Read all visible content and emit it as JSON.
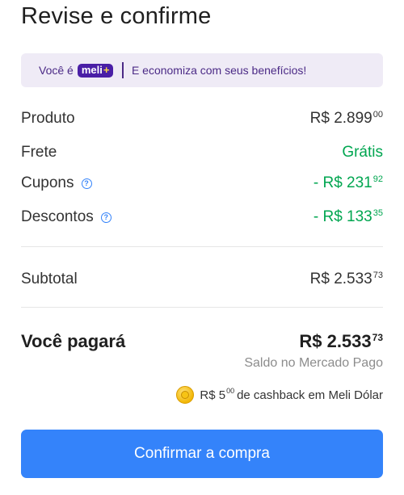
{
  "page": {
    "title": "Revise e confirme"
  },
  "banner": {
    "prefix": "Você é",
    "badge_text": "meli",
    "badge_plus": "+",
    "message": "E economiza com seus benefícios!",
    "colors": {
      "background": "#efebf6",
      "text": "#4b2a86",
      "badge": "#4a1fa6"
    }
  },
  "summary": {
    "produto": {
      "label": "Produto",
      "main": "R$ 2.899",
      "cents": "00"
    },
    "frete": {
      "label": "Frete",
      "value": "Grátis"
    },
    "cupons": {
      "label": "Cupons",
      "main": "- R$ 231",
      "cents": "92",
      "icon": "help-circle-icon"
    },
    "descontos": {
      "label": "Descontos",
      "main": "- R$ 133",
      "cents": "35",
      "icon": "help-circle-icon"
    },
    "subtotal": {
      "label": "Subtotal",
      "main": "R$ 2.533",
      "cents": "73"
    }
  },
  "total": {
    "label": "Você pagará",
    "main": "R$ 2.533",
    "cents": "73",
    "payment_method": "Saldo no Mercado Pago"
  },
  "cashback": {
    "icon": "coin-icon",
    "amount_main": "R$ 5",
    "amount_cents": "00",
    "text": "de cashback em Meli Dólar"
  },
  "actions": {
    "confirm_label": "Confirmar a compra"
  },
  "colors": {
    "accent": "#3483fa",
    "positive": "#00a650",
    "muted": "#8c8c8c"
  }
}
